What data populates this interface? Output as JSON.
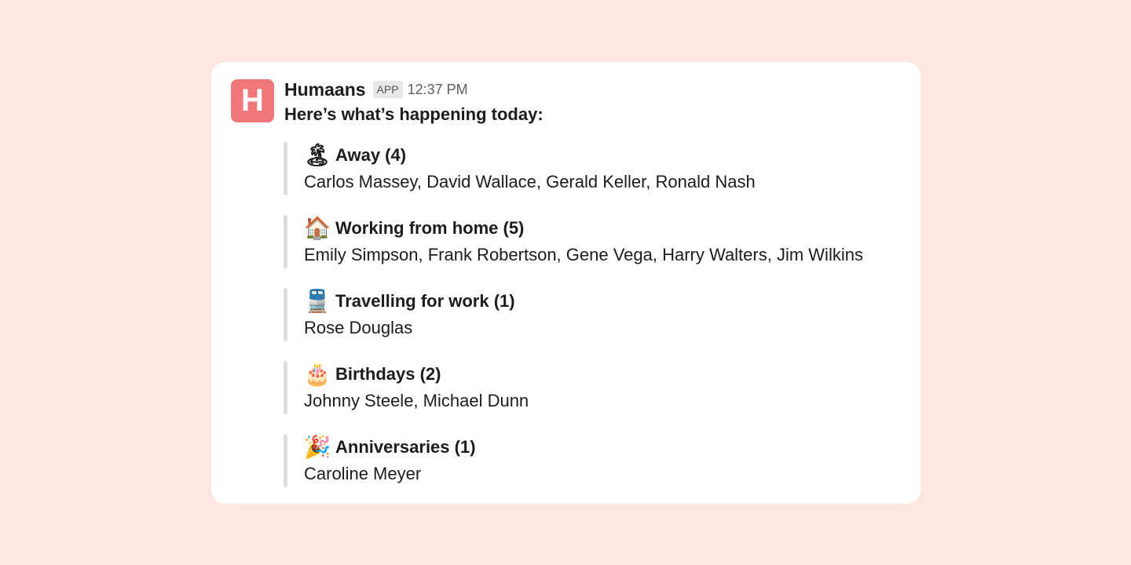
{
  "message": {
    "avatar_letter": "H",
    "sender": "Humaans",
    "badge": "APP",
    "time": "12:37 PM",
    "intro": "Here’s what’s happening today:"
  },
  "sections": [
    {
      "icon": "island-icon",
      "emoji": "🏝",
      "title": "Away (4)",
      "names": "Carlos Massey, David Wallace, Gerald Keller, Ronald Nash"
    },
    {
      "icon": "house-icon",
      "emoji": "🏠",
      "title": "Working from home (5)",
      "names": "Emily Simpson, Frank Robertson, Gene Vega, Harry Walters, Jim Wilkins"
    },
    {
      "icon": "train-icon",
      "emoji": "🚆",
      "title": "Travelling for work (1)",
      "names": "Rose Douglas"
    },
    {
      "icon": "cake-icon",
      "emoji": "🎂",
      "title": "Birthdays (2)",
      "names": "Johnny Steele, Michael Dunn"
    },
    {
      "icon": "party-popper-icon",
      "emoji": "🎉",
      "title": "Anniversaries (1)",
      "names": "Caroline Meyer"
    }
  ],
  "colors": {
    "background": "#fde7e0",
    "avatar": "#f0787a",
    "quote_bar": "#dddddd"
  }
}
